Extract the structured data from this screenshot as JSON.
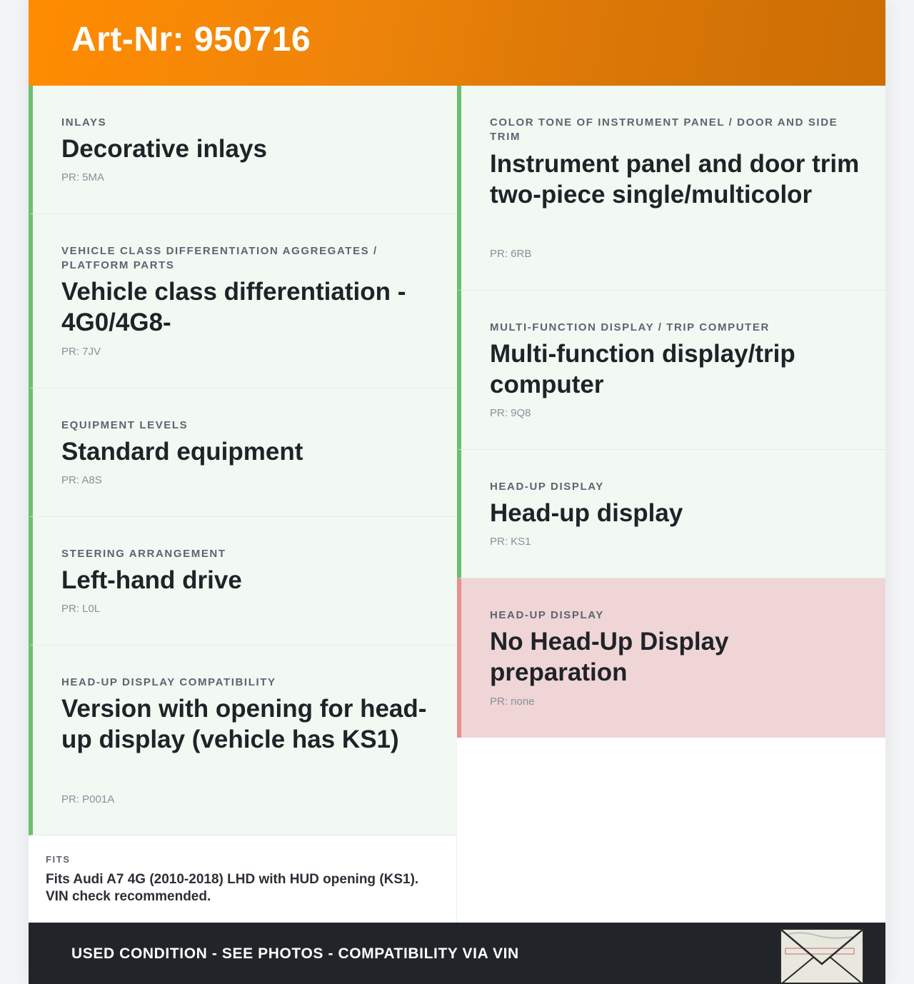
{
  "header": {
    "title": "Art-Nr: 950716"
  },
  "left_cards": [
    {
      "label": "INLAYS",
      "title": "Decorative inlays",
      "pr": "PR: 5MA"
    },
    {
      "label": "VEHICLE CLASS DIFFERENTIATION AGGREGATES / PLATFORM PARTS",
      "title": "Vehicle class differentiation - 4G0/4G8-",
      "pr": "PR: 7JV"
    },
    {
      "label": "EQUIPMENT LEVELS",
      "title": "Standard equipment",
      "pr": "PR: A8S"
    },
    {
      "label": "STEERING ARRANGEMENT",
      "title": "Left-hand drive",
      "pr": "PR: L0L"
    },
    {
      "label": "HEAD-UP DISPLAY COMPATIBILITY",
      "title": "Version with opening for head-up display (vehicle has KS1)",
      "pr": "PR: P001A"
    }
  ],
  "right_cards": [
    {
      "label": "COLOR TONE OF INSTRUMENT PANEL / DOOR AND SIDE TRIM",
      "title": "Instrument panel and door trim two-piece single/multicolor",
      "pr": "PR: 6RB"
    },
    {
      "label": "MULTI-FUNCTION DISPLAY / TRIP COMPUTER",
      "title": "Multi-function display/trip computer",
      "pr": "PR: 9Q8"
    },
    {
      "label": "HEAD-UP DISPLAY",
      "title": "Head-up display",
      "pr": "PR: KS1"
    },
    {
      "label": "HEAD-UP DISPLAY",
      "title": "No Head-Up Display preparation",
      "pr": "PR: none",
      "status": "negative"
    }
  ],
  "fits": {
    "label": "FITS",
    "text": "Fits Audi A7 4G (2010-2018) LHD with HUD opening (KS1). VIN check recommended."
  },
  "footer": {
    "text": "USED CONDITION - SEE PHOTOS - COMPATIBILITY VIA VIN"
  },
  "colors": {
    "header_start": "#ff8c00",
    "header_end": "#cc6e05",
    "positive_accent": "#6bbf6f",
    "positive_bg": "#f2f8f2",
    "negative_accent": "#e88f92",
    "negative_bg": "#efd5d6",
    "footer_bg": "#212529"
  },
  "icons": {
    "footer_stamp": "envelope-stamp-icon"
  }
}
